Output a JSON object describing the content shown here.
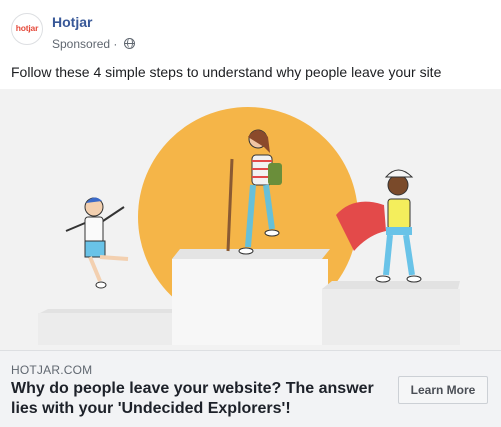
{
  "post": {
    "page_name": "Hotjar",
    "avatar_text": "hotjar",
    "sponsored_label": "Sponsored",
    "separator": "·",
    "privacy_icon": "globe-icon",
    "text": "Follow these 4 simple steps to understand why people leave your site"
  },
  "link": {
    "domain": "HOTJAR.COM",
    "headline": "Why do people leave your website? The answer lies with your 'Undecided Explorers'!",
    "cta_label": "Learn More"
  },
  "colors": {
    "page_name": "#385898",
    "logo": "#e5493a",
    "sun": "#f5b548",
    "cape": "#e34a4a",
    "footer_bg": "#f2f3f5"
  }
}
